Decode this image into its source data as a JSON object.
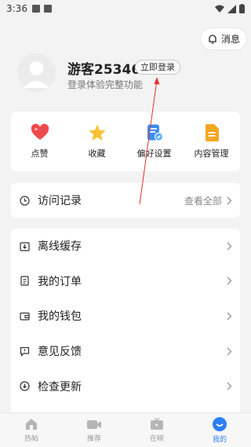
{
  "status_bar": {
    "time": "3:36"
  },
  "header": {
    "message_label": "消息"
  },
  "profile": {
    "username": "游客25346",
    "login_label": "立即登录",
    "subtitle": "登录体验完整功能"
  },
  "quick_actions": [
    {
      "label": "点赞",
      "icon": "heart-icon"
    },
    {
      "label": "收藏",
      "icon": "star-icon"
    },
    {
      "label": "偏好设置",
      "icon": "preferences-icon"
    },
    {
      "label": "内容管理",
      "icon": "content-manage-icon"
    }
  ],
  "history": {
    "label": "访问记录",
    "view_all": "查看全部"
  },
  "menu": [
    {
      "label": "离线缓存",
      "icon": "download-icon"
    },
    {
      "label": "我的订单",
      "icon": "order-icon"
    },
    {
      "label": "我的钱包",
      "icon": "wallet-icon"
    },
    {
      "label": "意见反馈",
      "icon": "feedback-icon"
    },
    {
      "label": "检查更新",
      "icon": "update-icon"
    }
  ],
  "tabbar": [
    {
      "label": "热帖",
      "icon": "home-icon",
      "active": false
    },
    {
      "label": "推荐",
      "icon": "video-icon",
      "active": false
    },
    {
      "label": "在映",
      "icon": "tv-icon",
      "active": false
    },
    {
      "label": "我的",
      "icon": "profile-icon",
      "active": true
    }
  ],
  "colors": {
    "accent": "#2b7ff5",
    "annotation": "#e0332c"
  }
}
